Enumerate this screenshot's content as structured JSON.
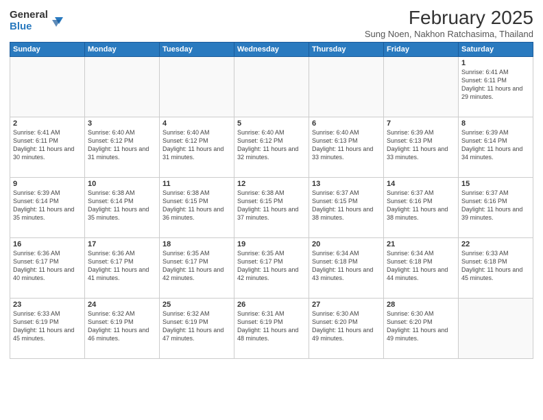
{
  "header": {
    "logo_general": "General",
    "logo_blue": "Blue",
    "month_title": "February 2025",
    "location": "Sung Noen, Nakhon Ratchasima, Thailand"
  },
  "weekdays": [
    "Sunday",
    "Monday",
    "Tuesday",
    "Wednesday",
    "Thursday",
    "Friday",
    "Saturday"
  ],
  "weeks": [
    [
      {
        "day": "",
        "info": ""
      },
      {
        "day": "",
        "info": ""
      },
      {
        "day": "",
        "info": ""
      },
      {
        "day": "",
        "info": ""
      },
      {
        "day": "",
        "info": ""
      },
      {
        "day": "",
        "info": ""
      },
      {
        "day": "1",
        "info": "Sunrise: 6:41 AM\nSunset: 6:11 PM\nDaylight: 11 hours and 29 minutes."
      }
    ],
    [
      {
        "day": "2",
        "info": "Sunrise: 6:41 AM\nSunset: 6:11 PM\nDaylight: 11 hours and 30 minutes."
      },
      {
        "day": "3",
        "info": "Sunrise: 6:40 AM\nSunset: 6:12 PM\nDaylight: 11 hours and 31 minutes."
      },
      {
        "day": "4",
        "info": "Sunrise: 6:40 AM\nSunset: 6:12 PM\nDaylight: 11 hours and 31 minutes."
      },
      {
        "day": "5",
        "info": "Sunrise: 6:40 AM\nSunset: 6:12 PM\nDaylight: 11 hours and 32 minutes."
      },
      {
        "day": "6",
        "info": "Sunrise: 6:40 AM\nSunset: 6:13 PM\nDaylight: 11 hours and 33 minutes."
      },
      {
        "day": "7",
        "info": "Sunrise: 6:39 AM\nSunset: 6:13 PM\nDaylight: 11 hours and 33 minutes."
      },
      {
        "day": "8",
        "info": "Sunrise: 6:39 AM\nSunset: 6:14 PM\nDaylight: 11 hours and 34 minutes."
      }
    ],
    [
      {
        "day": "9",
        "info": "Sunrise: 6:39 AM\nSunset: 6:14 PM\nDaylight: 11 hours and 35 minutes."
      },
      {
        "day": "10",
        "info": "Sunrise: 6:38 AM\nSunset: 6:14 PM\nDaylight: 11 hours and 35 minutes."
      },
      {
        "day": "11",
        "info": "Sunrise: 6:38 AM\nSunset: 6:15 PM\nDaylight: 11 hours and 36 minutes."
      },
      {
        "day": "12",
        "info": "Sunrise: 6:38 AM\nSunset: 6:15 PM\nDaylight: 11 hours and 37 minutes."
      },
      {
        "day": "13",
        "info": "Sunrise: 6:37 AM\nSunset: 6:15 PM\nDaylight: 11 hours and 38 minutes."
      },
      {
        "day": "14",
        "info": "Sunrise: 6:37 AM\nSunset: 6:16 PM\nDaylight: 11 hours and 38 minutes."
      },
      {
        "day": "15",
        "info": "Sunrise: 6:37 AM\nSunset: 6:16 PM\nDaylight: 11 hours and 39 minutes."
      }
    ],
    [
      {
        "day": "16",
        "info": "Sunrise: 6:36 AM\nSunset: 6:17 PM\nDaylight: 11 hours and 40 minutes."
      },
      {
        "day": "17",
        "info": "Sunrise: 6:36 AM\nSunset: 6:17 PM\nDaylight: 11 hours and 41 minutes."
      },
      {
        "day": "18",
        "info": "Sunrise: 6:35 AM\nSunset: 6:17 PM\nDaylight: 11 hours and 42 minutes."
      },
      {
        "day": "19",
        "info": "Sunrise: 6:35 AM\nSunset: 6:17 PM\nDaylight: 11 hours and 42 minutes."
      },
      {
        "day": "20",
        "info": "Sunrise: 6:34 AM\nSunset: 6:18 PM\nDaylight: 11 hours and 43 minutes."
      },
      {
        "day": "21",
        "info": "Sunrise: 6:34 AM\nSunset: 6:18 PM\nDaylight: 11 hours and 44 minutes."
      },
      {
        "day": "22",
        "info": "Sunrise: 6:33 AM\nSunset: 6:18 PM\nDaylight: 11 hours and 45 minutes."
      }
    ],
    [
      {
        "day": "23",
        "info": "Sunrise: 6:33 AM\nSunset: 6:19 PM\nDaylight: 11 hours and 45 minutes."
      },
      {
        "day": "24",
        "info": "Sunrise: 6:32 AM\nSunset: 6:19 PM\nDaylight: 11 hours and 46 minutes."
      },
      {
        "day": "25",
        "info": "Sunrise: 6:32 AM\nSunset: 6:19 PM\nDaylight: 11 hours and 47 minutes."
      },
      {
        "day": "26",
        "info": "Sunrise: 6:31 AM\nSunset: 6:19 PM\nDaylight: 11 hours and 48 minutes."
      },
      {
        "day": "27",
        "info": "Sunrise: 6:30 AM\nSunset: 6:20 PM\nDaylight: 11 hours and 49 minutes."
      },
      {
        "day": "28",
        "info": "Sunrise: 6:30 AM\nSunset: 6:20 PM\nDaylight: 11 hours and 49 minutes."
      },
      {
        "day": "",
        "info": ""
      }
    ]
  ]
}
